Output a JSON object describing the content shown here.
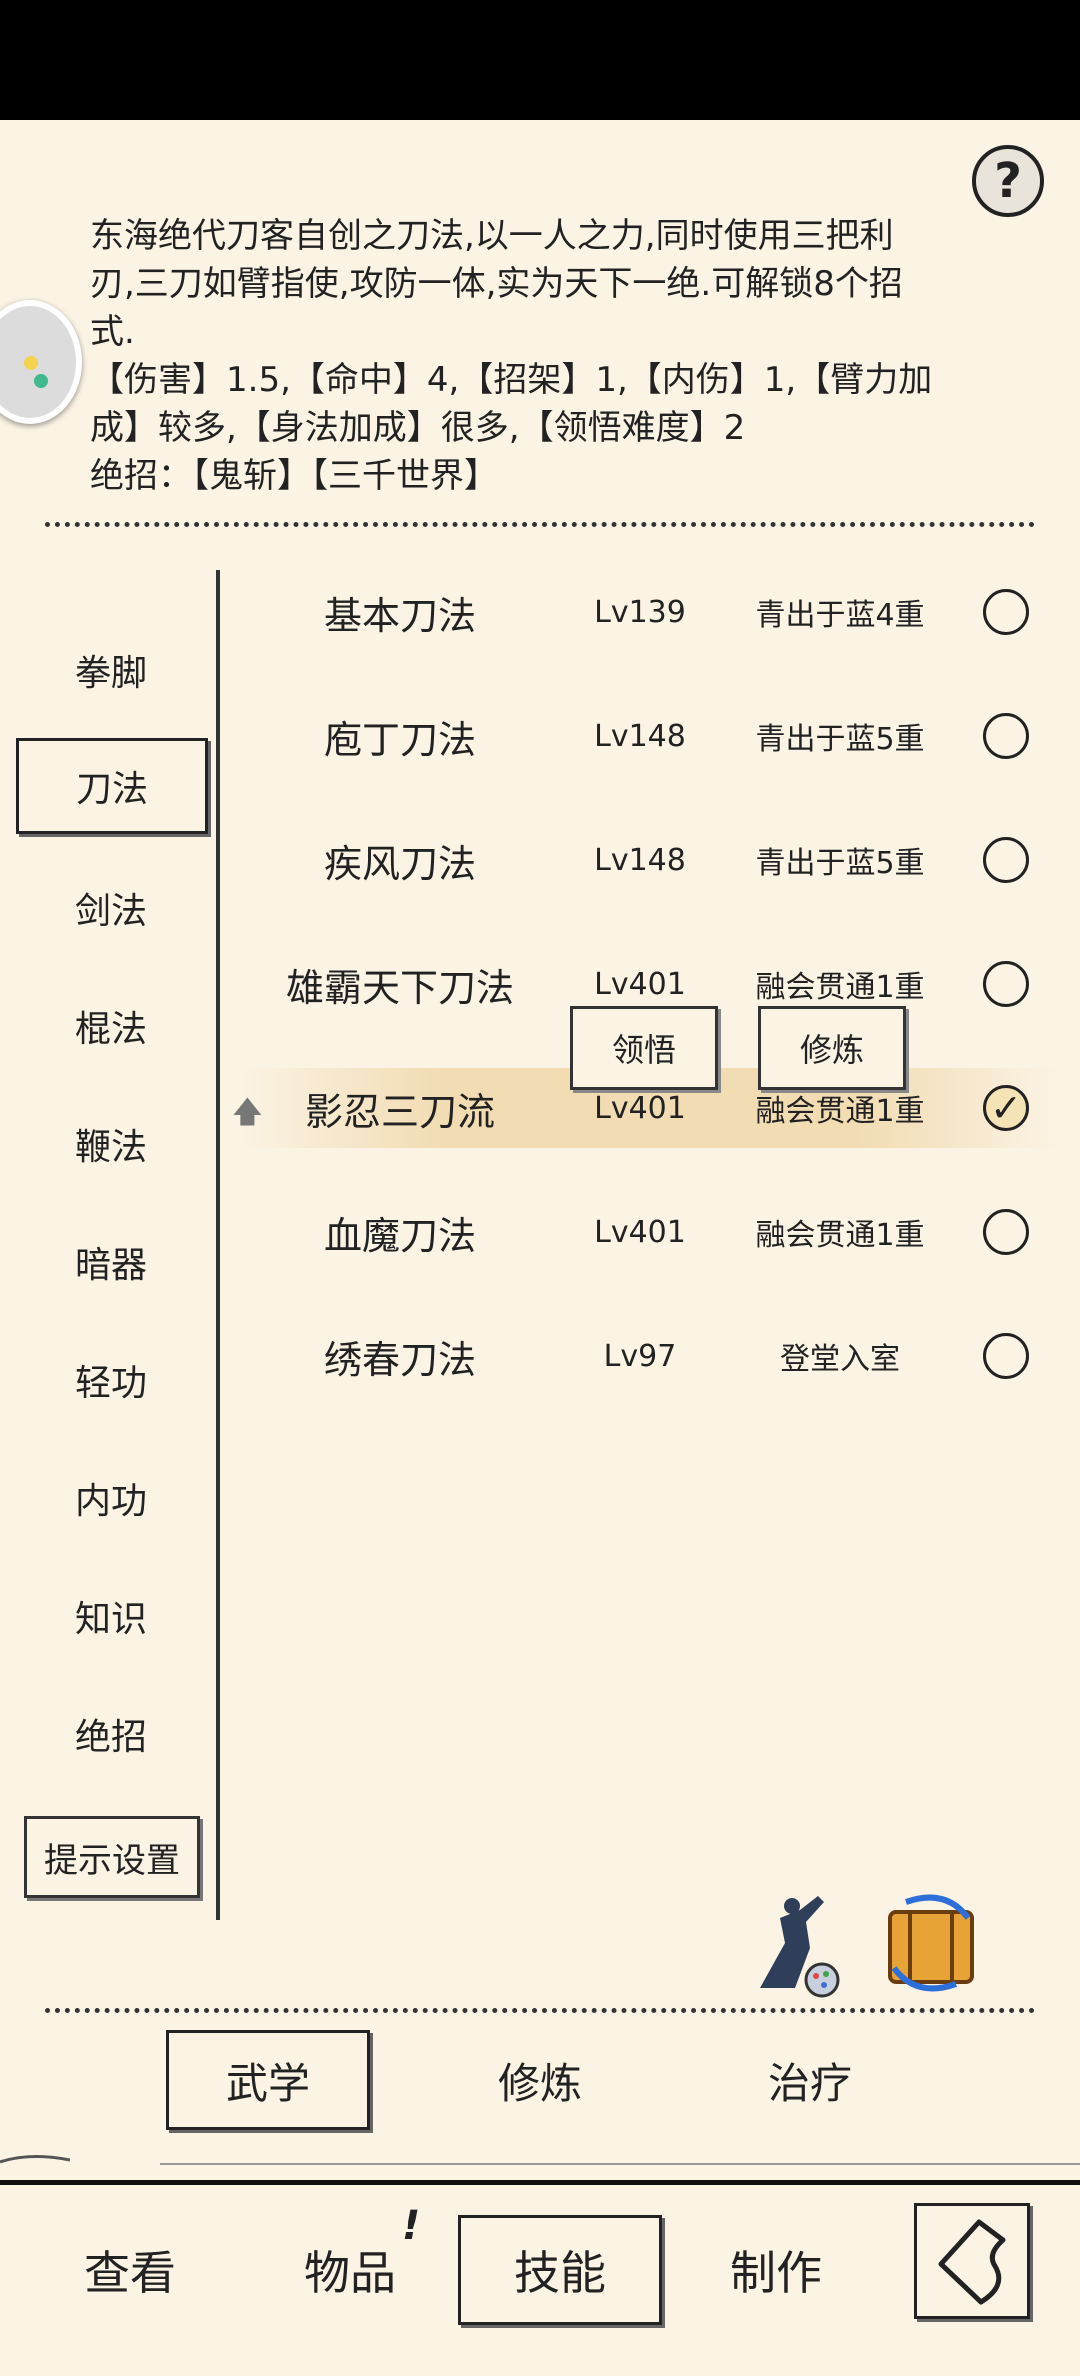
{
  "help_label": "?",
  "description": {
    "lines": [
      "东海绝代刀客自创之刀法,以一人之力,同时使用三把利",
      "刃,三刀如臂指使,攻防一体,实为天下一绝.可解锁8个招",
      "式.",
      "【伤害】1.5,【命中】4,【招架】1,【内伤】1,【臂力加",
      "成】较多,【身法加成】很多,【领悟难度】2",
      "绝招：【鬼斩】【三千世界】"
    ]
  },
  "categories": [
    "拳脚",
    "刀法",
    "剑法",
    "棍法",
    "鞭法",
    "暗器",
    "轻功",
    "内功",
    "知识",
    "绝招"
  ],
  "active_category": "刀法",
  "tip_settings_label": "提示设置",
  "skills": [
    {
      "name": "基本刀法",
      "level": "Lv139",
      "rank": "青出于蓝4重",
      "checked": false
    },
    {
      "name": "庖丁刀法",
      "level": "Lv148",
      "rank": "青出于蓝5重",
      "checked": false
    },
    {
      "name": "疾风刀法",
      "level": "Lv148",
      "rank": "青出于蓝5重",
      "checked": false
    },
    {
      "name": "雄霸天下刀法",
      "level": "Lv401",
      "rank": "融会贯通1重",
      "checked": false
    },
    {
      "name": "影忍三刀流",
      "level": "Lv401",
      "rank": "融会贯通1重",
      "checked": true
    },
    {
      "name": "血魔刀法",
      "level": "Lv401",
      "rank": "融会贯通1重",
      "checked": false
    },
    {
      "name": "绣春刀法",
      "level": "Lv97",
      "rank": "登堂入室",
      "checked": false
    }
  ],
  "popup": {
    "comprehend": "领悟",
    "practice": "修炼"
  },
  "tabs": [
    "武学",
    "修炼",
    "治疗"
  ],
  "active_tab": "武学",
  "bottom_nav": {
    "view": "查看",
    "items": "物品",
    "items_badge": "!",
    "skills": "技能",
    "craft": "制作"
  },
  "colors": {
    "background": "#fbf3e4",
    "selected_row": "#f0d8aa",
    "ink": "#222222"
  }
}
